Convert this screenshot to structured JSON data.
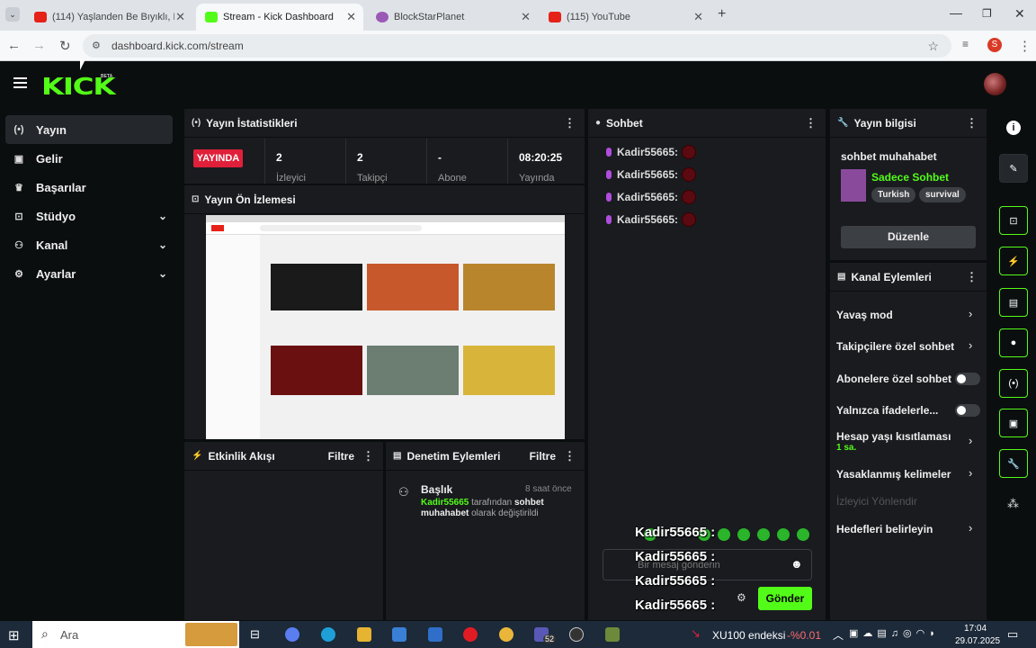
{
  "browser": {
    "tabs": [
      {
        "label": "(114) Yaşlanden Be Bıyıklı, Dünd",
        "color": "#e62117"
      },
      {
        "label": "Stream - Kick Dashboard",
        "color": "#53fc18"
      },
      {
        "label": "BlockStarPlanet",
        "color": "#9b59b6"
      },
      {
        "label": "(115) YouTube",
        "color": "#e62117"
      }
    ],
    "url": "dashboard.kick.com/stream",
    "profile_initial": "S"
  },
  "kick": {
    "logo": "KICK",
    "beta": "BETA"
  },
  "nav": [
    {
      "label": "Yayın",
      "icon": "(•)"
    },
    {
      "label": "Gelir",
      "icon": "▣"
    },
    {
      "label": "Başarılar",
      "icon": "♛"
    },
    {
      "label": "Stüdyo",
      "icon": "⊡"
    },
    {
      "label": "Kanal",
      "icon": "⚇"
    },
    {
      "label": "Ayarlar",
      "icon": "⚙"
    }
  ],
  "stats": {
    "title": "Yayın İstatistikleri",
    "live_badge": "YAYINDA",
    "items": [
      {
        "value": "2",
        "label": "İzleyici"
      },
      {
        "value": "2",
        "label": "Takipçi"
      },
      {
        "value": "-",
        "label": "Abone"
      },
      {
        "value": "08:20:25",
        "label": "Yayında"
      }
    ]
  },
  "preview": {
    "title": "Yayın Ön İzlemesi"
  },
  "activity": {
    "title": "Etkinlik Akışı",
    "filter": "Filtre"
  },
  "moderation": {
    "title": "Denetim Eylemleri",
    "filter": "Filtre",
    "entry_title": "Başlık",
    "entry_time": "8 saat önce",
    "entry_user": "Kadir55665",
    "entry_text1": "tarafından",
    "entry_bold": "sohbet muhahabet",
    "entry_text2": "olarak değiştirildi"
  },
  "chat": {
    "title": "Sohbet",
    "messages": [
      "Kadir55665:",
      "Kadir55665:",
      "Kadir55665:",
      "Kadir55665:"
    ],
    "input_placeholder": "Bir mesaj gönderin",
    "send": "Gönder",
    "overlay": [
      "Kadir55665 :",
      "Kadir55665 :",
      "Kadir55665 :",
      "Kadir55665 :"
    ]
  },
  "info": {
    "title": "Yayın bilgisi",
    "stream_title": "sohbet muhahabet",
    "category": "Sadece Sohbet",
    "tags": [
      "Turkish",
      "survival"
    ],
    "edit": "Düzenle"
  },
  "channel_actions": {
    "title": "Kanal Eylemleri",
    "items": [
      {
        "label": "Yavaş mod"
      },
      {
        "label": "Takipçilere özel sohbet"
      },
      {
        "label": "Abonelere özel sohbet"
      },
      {
        "label": "Yalnızca ifadelerle..."
      },
      {
        "label": "Hesap yaşı kısıtlaması",
        "sub": "1 sa."
      },
      {
        "label": "Yasaklanmış kelimeler"
      },
      {
        "label": "İzleyici Yönlendir"
      },
      {
        "label": "Hedefleri belirleyin"
      }
    ]
  },
  "taskbar": {
    "search": "Ara",
    "stock": "XU100 endeksi",
    "stock_change": "-%0.01",
    "badge": "52",
    "time": "17:04",
    "date": "29.07.2025"
  }
}
